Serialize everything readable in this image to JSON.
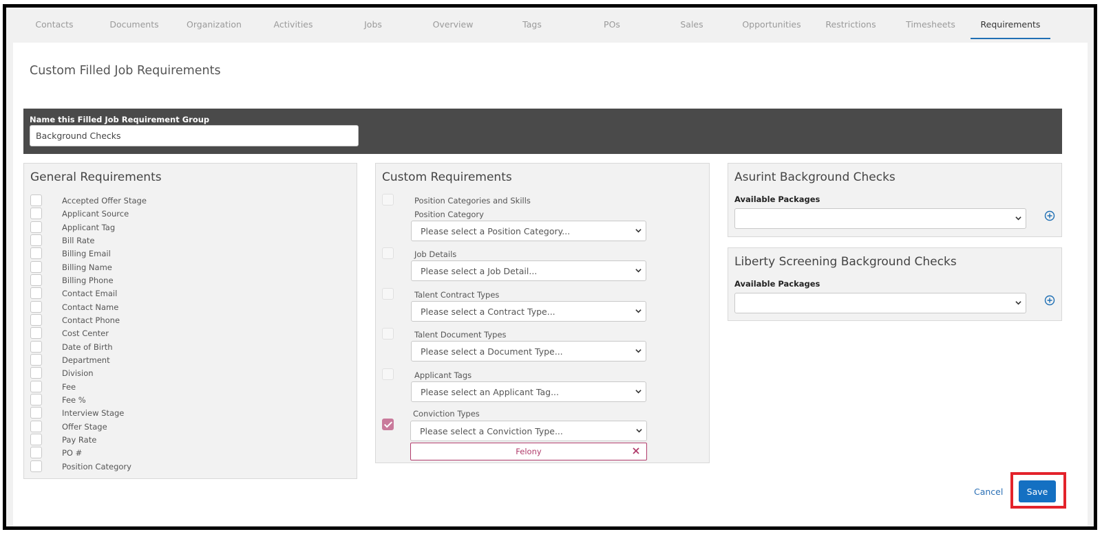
{
  "tabs": [
    "Contacts",
    "Documents",
    "Organization",
    "Activities",
    "Jobs",
    "Overview",
    "Tags",
    "POs",
    "Sales",
    "Opportunities",
    "Restrictions",
    "Timesheets",
    "Requirements"
  ],
  "active_tab": "Requirements",
  "page_title": "Custom Filled Job Requirements",
  "group": {
    "label": "Name this Filled Job Requirement Group",
    "value": "Background Checks"
  },
  "general": {
    "title": "General Requirements",
    "items": [
      "Accepted Offer Stage",
      "Applicant Source",
      "Applicant Tag",
      "Bill Rate",
      "Billing Email",
      "Billing Name",
      "Billing Phone",
      "Contact Email",
      "Contact Name",
      "Contact Phone",
      "Cost Center",
      "Date of Birth",
      "Department",
      "Division",
      "Fee",
      "Fee %",
      "Interview Stage",
      "Offer Stage",
      "Pay Rate",
      "PO #",
      "Position Category"
    ]
  },
  "custom": {
    "title": "Custom Requirements",
    "sections": [
      {
        "label": "Position Categories and Skills",
        "sublabel": "Position Category",
        "placeholder": "Please select a Position Category...",
        "checked": false
      },
      {
        "label": "Job Details",
        "placeholder": "Please select a Job Detail...",
        "checked": false
      },
      {
        "label": "Talent Contract Types",
        "placeholder": "Please select a Contract Type...",
        "checked": false
      },
      {
        "label": "Talent Document Types",
        "placeholder": "Please select a Document Type...",
        "checked": false
      },
      {
        "label": "Applicant Tags",
        "placeholder": "Please select an Applicant Tag...",
        "checked": false
      },
      {
        "label": "Conviction Types",
        "placeholder": "Please select a Conviction Type...",
        "checked": true,
        "selected_tag": "Felony"
      }
    ]
  },
  "asurint": {
    "title": "Asurint Background Checks",
    "label": "Available Packages"
  },
  "liberty": {
    "title": "Liberty Screening Background Checks",
    "label": "Available Packages"
  },
  "actions": {
    "cancel": "Cancel",
    "save": "Save"
  },
  "colors": {
    "accent": "#1470c2",
    "tag": "#b03a6a",
    "checked": "#c97a9b",
    "highlight": "#e3232b"
  }
}
